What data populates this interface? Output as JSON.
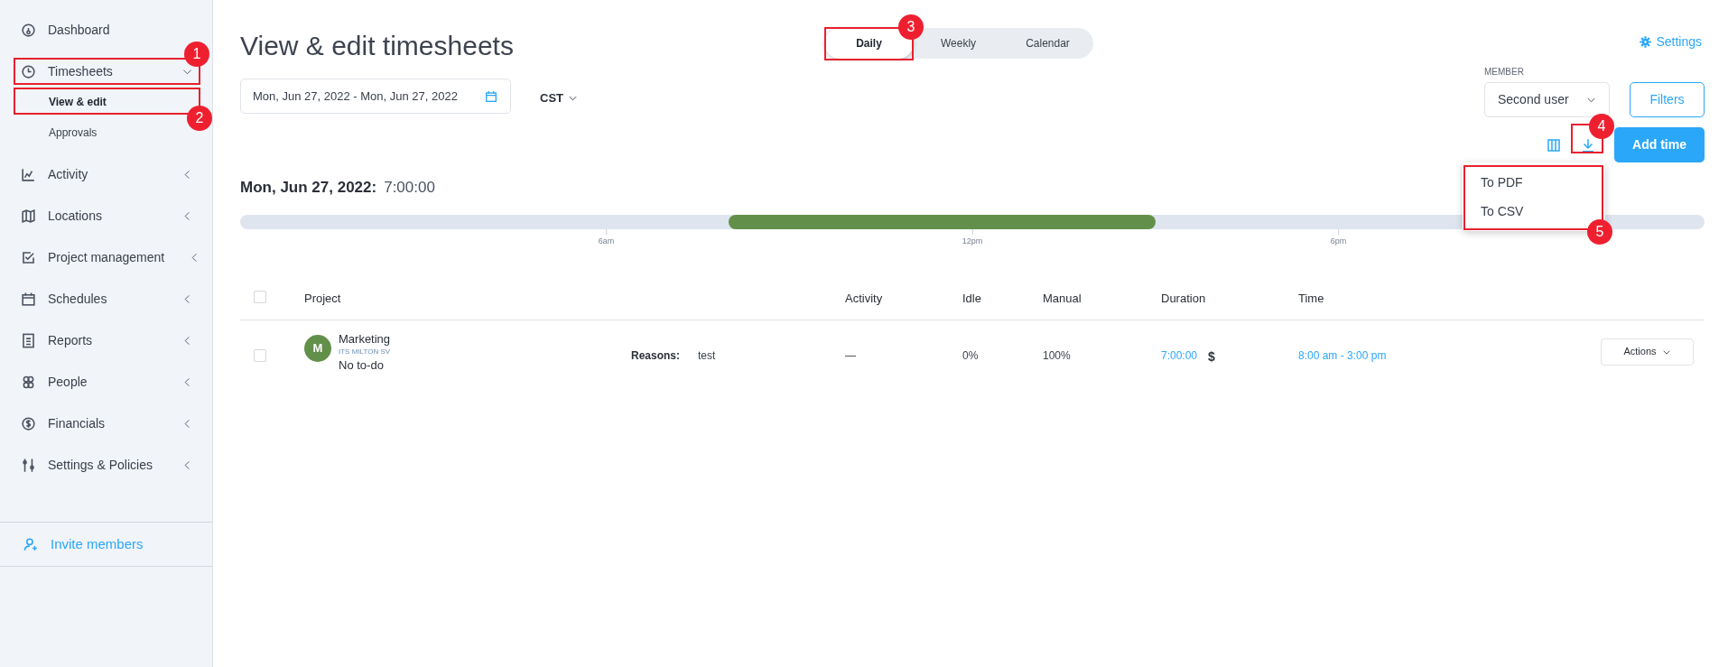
{
  "sidebar": {
    "items": [
      {
        "label": "Dashboard"
      },
      {
        "label": "Timesheets",
        "expanded": true,
        "children": [
          {
            "label": "View & edit",
            "selected": true
          },
          {
            "label": "Approvals",
            "selected": false
          }
        ]
      },
      {
        "label": "Activity",
        "expanded": false
      },
      {
        "label": "Locations",
        "expanded": false
      },
      {
        "label": "Project management",
        "expanded": false
      },
      {
        "label": "Schedules",
        "expanded": false
      },
      {
        "label": "Reports",
        "expanded": false
      },
      {
        "label": "People",
        "expanded": false
      },
      {
        "label": "Financials",
        "expanded": false
      },
      {
        "label": "Settings & Policies",
        "expanded": false
      }
    ],
    "invite": "Invite members"
  },
  "page": {
    "title": "View & edit timesheets",
    "settings": "Settings"
  },
  "view_tabs": [
    {
      "label": "Daily",
      "selected": true
    },
    {
      "label": "Weekly",
      "selected": false
    },
    {
      "label": "Calendar",
      "selected": false
    }
  ],
  "date_range": "Mon, Jun 27, 2022 - Mon, Jun 27, 2022",
  "timezone": "CST",
  "member": {
    "label": "MEMBER",
    "value": "Second user"
  },
  "filters": "Filters",
  "add_time": "Add time",
  "export_menu": [
    "To PDF",
    "To CSV"
  ],
  "day": {
    "date": "Mon, Jun 27, 2022:",
    "total": "7:00:00",
    "ticks": [
      "6am",
      "12pm",
      "6pm"
    ]
  },
  "table": {
    "columns": [
      "Project",
      "Activity",
      "Idle",
      "Manual",
      "Duration",
      "Time"
    ],
    "all_checked": false,
    "rows": [
      {
        "checked": false,
        "avatar": "M",
        "project": "Marketing",
        "client": "ITS MILTON SV",
        "todo": "No to-do",
        "reasons_label": "Reasons:",
        "reasons": "test",
        "activity": "—",
        "idle": "0%",
        "manual": "100%",
        "duration": "7:00:00",
        "currency": "$",
        "time": "8:00 am - 3:00 pm",
        "actions": "Actions"
      }
    ]
  },
  "callouts": [
    "1",
    "2",
    "3",
    "4",
    "5"
  ]
}
